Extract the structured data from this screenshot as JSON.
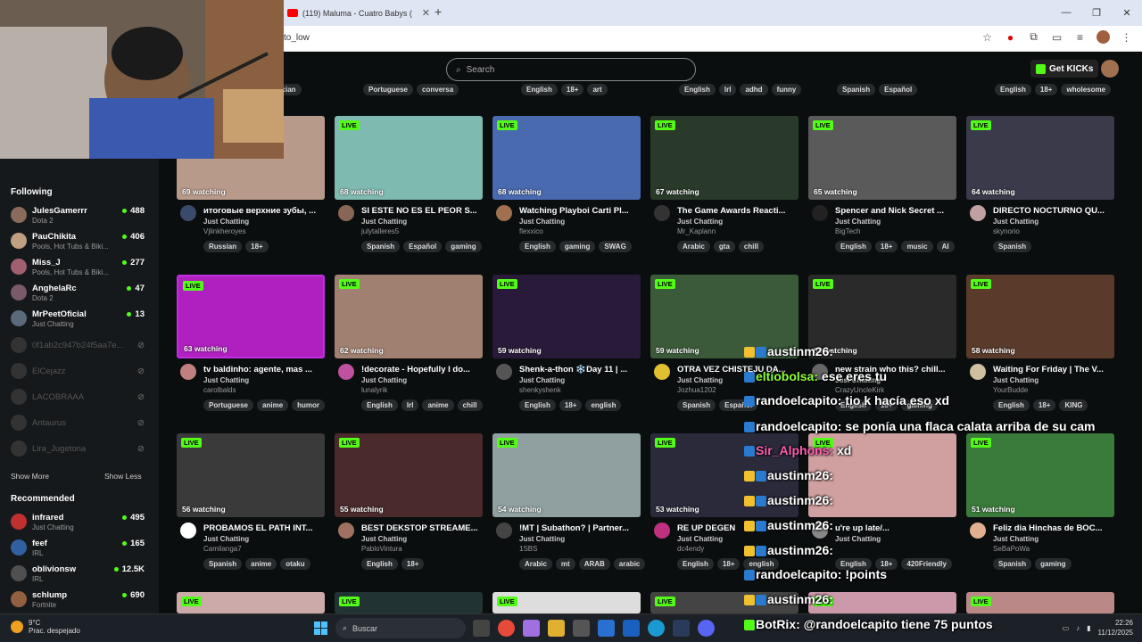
{
  "browser": {
    "tab_title": "(119) Maluma - Cuatro Babys (",
    "url": "to_low"
  },
  "header": {
    "search_placeholder": "Search",
    "get_kicks": "Get KICKs"
  },
  "top_tags": [
    [
      "usician"
    ],
    [
      "Portuguese",
      "conversa"
    ],
    [
      "English",
      "18+",
      "art"
    ],
    [
      "English",
      "Irl",
      "adhd",
      "funny"
    ],
    [
      "Spanish",
      "Español"
    ],
    [
      "English",
      "18+",
      "wholesome"
    ]
  ],
  "sidebar": {
    "following_title": "Following",
    "following": [
      {
        "name": "JulesGamerrr",
        "cat": "Dota 2",
        "viewers": "488",
        "color": "#8a6a5a"
      },
      {
        "name": "PauChikita",
        "cat": "Pools, Hot Tubs & Biki...",
        "viewers": "406",
        "color": "#c0a080"
      },
      {
        "name": "Miss_J",
        "cat": "Pools, Hot Tubs & Biki...",
        "viewers": "277",
        "color": "#a06070"
      },
      {
        "name": "AnghelaRc",
        "cat": "Dota 2",
        "viewers": "47",
        "color": "#7a5a6a"
      },
      {
        "name": "MrPeetOficial",
        "cat": "Just Chatting",
        "viewers": "13",
        "color": "#5a6a7a"
      }
    ],
    "offline": [
      "0f1ab2c947b24f5aa7e...",
      "ElCejazz",
      "LACOBRAAA",
      "Antaurus",
      "Lira_Jugetona"
    ],
    "show_more": "Show More",
    "show_less": "Show Less",
    "recommended_title": "Recommended",
    "recommended": [
      {
        "name": "infrared",
        "cat": "Just Chatting",
        "viewers": "495",
        "color": "#c03030"
      },
      {
        "name": "feef",
        "cat": "IRL",
        "viewers": "165",
        "color": "#3060a0"
      },
      {
        "name": "oblivionsw",
        "cat": "IRL",
        "viewers": "12.5K",
        "color": "#505050"
      },
      {
        "name": "schlump",
        "cat": "Fortnite",
        "viewers": "690",
        "color": "#906040"
      }
    ]
  },
  "cards": [
    {
      "title": "итоговые верхние зубы, ...",
      "cat": "Just Chatting",
      "user": "Vjlinkheroyes",
      "watching": "69 watching",
      "tags": [
        "Russian",
        "18+"
      ],
      "bg": "#b89a8a",
      "av": "#3a4a6a"
    },
    {
      "title": "SI ESTE NO ES EL PEOR S...",
      "cat": "Just Chatting",
      "user": "julytalleres5",
      "watching": "68 watching",
      "tags": [
        "Spanish",
        "Español",
        "gaming"
      ],
      "bg": "#7fbab0",
      "av": "#886655"
    },
    {
      "title": "Watching Playboi Carti Pl...",
      "cat": "Just Chatting",
      "user": "flexxico",
      "watching": "68 watching",
      "tags": [
        "English",
        "gaming",
        "SWAG"
      ],
      "bg": "#4a6ab0",
      "av": "#a07050"
    },
    {
      "title": "The Game Awards Reacti...",
      "cat": "Just Chatting",
      "user": "Mr_Kaplann",
      "watching": "67 watching",
      "tags": [
        "Arabic",
        "gta",
        "chill"
      ],
      "bg": "#2a3a2a",
      "av": "#333"
    },
    {
      "title": "Spencer and Nick Secret ...",
      "cat": "Just Chatting",
      "user": "BigTech",
      "watching": "65 watching",
      "tags": [
        "English",
        "18+",
        "music",
        "AI"
      ],
      "bg": "#5a5a5a",
      "av": "#222"
    },
    {
      "title": "DIRECTO NOCTURNO QU...",
      "cat": "Just Chatting",
      "user": "skynorio",
      "watching": "64 watching",
      "tags": [
        "Spanish"
      ],
      "bg": "#3a3a4a",
      "av": "#c0a0a0"
    },
    {
      "title": "tv baldinho: agente, mas ...",
      "cat": "Just Chatting",
      "user": "carolbalds",
      "watching": "63 watching",
      "tags": [
        "Portuguese",
        "anime",
        "humor"
      ],
      "bg": "#b020c0",
      "av": "#c08080"
    },
    {
      "title": "!decorate - Hopefully I do...",
      "cat": "Just Chatting",
      "user": "lunalyrik",
      "watching": "62 watching",
      "tags": [
        "English",
        "Irl",
        "anime",
        "chill"
      ],
      "bg": "#a08070",
      "av": "#c050a0"
    },
    {
      "title": "Shenk-a-thon ❄️Day 11 | ...",
      "cat": "Just Chatting",
      "user": "shenkyshenk",
      "watching": "59 watching",
      "tags": [
        "English",
        "18+",
        "english"
      ],
      "bg": "#2a1a3a",
      "av": "#555"
    },
    {
      "title": "OTRA VEZ CHISTEJU DA...",
      "cat": "Just Chatting",
      "user": "Jozhua1202",
      "watching": "59 watching",
      "tags": [
        "Spanish",
        "Español"
      ],
      "bg": "#3a5a3a",
      "av": "#e0c030"
    },
    {
      "title": "new strain who this? chill...",
      "cat": "Just Chatting",
      "user": "CrazyUncleKirk",
      "watching": "58 watching",
      "tags": [
        "English",
        "18+",
        "gaming"
      ],
      "bg": "#2a2a2a",
      "av": "#666"
    },
    {
      "title": "Waiting For Friday | The V...",
      "cat": "Just Chatting",
      "user": "YourBudde",
      "watching": "58 watching",
      "tags": [
        "English",
        "18+",
        "KING"
      ],
      "bg": "#5a3a2a",
      "av": "#d0c0a0"
    },
    {
      "title": "PROBAMOS EL PATH INT...",
      "cat": "Just Chatting",
      "user": "Camilanga7",
      "watching": "56 watching",
      "tags": [
        "Spanish",
        "anime",
        "otaku"
      ],
      "bg": "#3a3a3a",
      "av": "#fff"
    },
    {
      "title": "BEST DEKSTOP STREAME...",
      "cat": "Just Chatting",
      "user": "PabloVintura",
      "watching": "55 watching",
      "tags": [
        "English",
        "18+"
      ],
      "bg": "#4a2a2a",
      "av": "#a07060"
    },
    {
      "title": "!MT | Subathon? | Partner...",
      "cat": "Just Chatting",
      "user": "1SBS",
      "watching": "54 watching",
      "tags": [
        "Arabic",
        "mt",
        "ARAB",
        "arabic"
      ],
      "bg": "#90a0a0",
      "av": "#444"
    },
    {
      "title": "RE UP DEGEN",
      "cat": "Just Chatting",
      "user": "dc4endy",
      "watching": "53 watching",
      "tags": [
        "English",
        "18+",
        "english"
      ],
      "bg": "#2a2a3a",
      "av": "#c03080"
    },
    {
      "title": "u're up late/...",
      "cat": "Just Chatting",
      "user": "",
      "watching": "",
      "tags": [
        "English",
        "18+",
        "420Friendly"
      ],
      "bg": "#d0a0a0",
      "av": "#888"
    },
    {
      "title": "Feliz dia Hinchas de BOC...",
      "cat": "Just Chatting",
      "user": "SeBaPoWa",
      "watching": "51 watching",
      "tags": [
        "Spanish",
        "gaming"
      ],
      "bg": "#3a7a3a",
      "av": "#e0b090"
    }
  ],
  "chat": [
    {
      "user": "austinm26:",
      "msg": "",
      "ucolor": "#fff"
    },
    {
      "user": "eltiobolsa:",
      "msg": " ese eres tu",
      "ucolor": "#8dff3a"
    },
    {
      "user": "randoelcapito:",
      "msg": " tio k hacía eso xd",
      "ucolor": "#fff"
    },
    {
      "user": "randoelcapito:",
      "msg": " se ponía una flaca calata arriba de su cam",
      "ucolor": "#fff"
    },
    {
      "user": "Sir_Alphons:",
      "msg": " xd",
      "ucolor": "#ff5fb0"
    },
    {
      "user": "austinm26:",
      "msg": "",
      "ucolor": "#fff"
    },
    {
      "user": "austinm26:",
      "msg": "",
      "ucolor": "#fff"
    },
    {
      "user": "austinm26:",
      "msg": "",
      "ucolor": "#fff"
    },
    {
      "user": "austinm26:",
      "msg": "",
      "ucolor": "#fff"
    },
    {
      "user": "randoelcapito:",
      "msg": " !points",
      "ucolor": "#fff"
    },
    {
      "user": "austinm26:",
      "msg": "",
      "ucolor": "#fff"
    },
    {
      "user": "BotRix:",
      "msg": " @randoelcapito tiene 75 puntos",
      "ucolor": "#fff"
    }
  ],
  "taskbar": {
    "temp": "9°C",
    "weather": "Prac. despejado",
    "search": "Buscar",
    "time": "22:26",
    "date": "11/12/2025"
  }
}
